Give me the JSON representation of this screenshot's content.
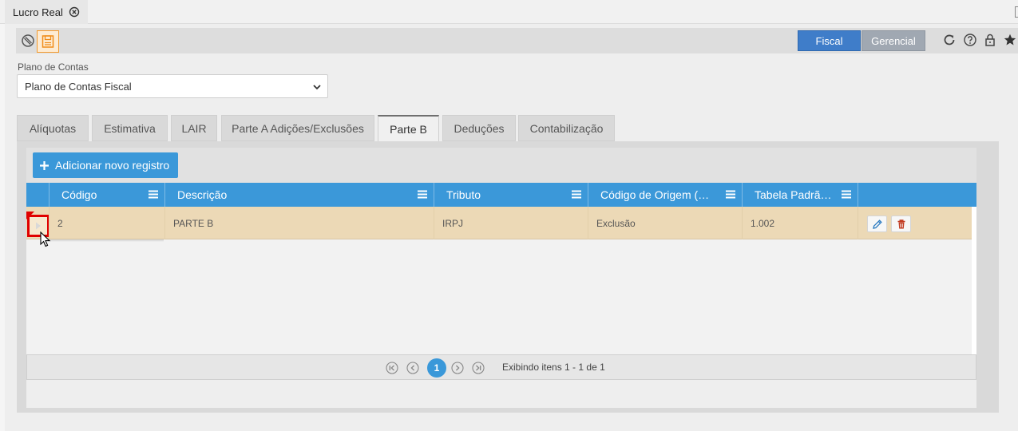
{
  "window_tab": {
    "title": "Lucro Real"
  },
  "toolbar": {
    "icons": [
      "block-icon",
      "save-icon",
      "refresh-icon",
      "help-icon",
      "lock-icon",
      "star-icon"
    ],
    "segment": {
      "fiscal": "Fiscal",
      "gerencial": "Gerencial",
      "active": "Fiscal"
    }
  },
  "plano": {
    "label": "Plano de Contas",
    "value": "Plano de Contas Fiscal"
  },
  "tabs": [
    {
      "label": "Alíquotas"
    },
    {
      "label": "Estimativa"
    },
    {
      "label": "LAIR"
    },
    {
      "label": "Parte A Adições/Exclusões"
    },
    {
      "label": "Parte B"
    },
    {
      "label": "Deduções"
    },
    {
      "label": "Contabilização"
    }
  ],
  "active_tab": "Parte B",
  "grid": {
    "add_label": "Adicionar novo registro",
    "columns": [
      {
        "label": "Código"
      },
      {
        "label": "Descrição"
      },
      {
        "label": "Tributo"
      },
      {
        "label": "Código de Origem (Pa..."
      },
      {
        "label": "Tabela Padrão..."
      }
    ],
    "rows": [
      {
        "codigo": "2",
        "descricao": "PARTE B",
        "tributo": "IRPJ",
        "codigo_origem": "Exclusão",
        "tabela_padrao": "1.002"
      }
    ]
  },
  "pager": {
    "current_page": "1",
    "info": "Exibindo itens 1 - 1 de 1"
  },
  "colors": {
    "primary": "#3a98d9",
    "row_selected": "#ecd9b6",
    "highlight": "#e00000",
    "fiscal": "#3f7dc9",
    "gerencial": "#a0a8b2"
  }
}
